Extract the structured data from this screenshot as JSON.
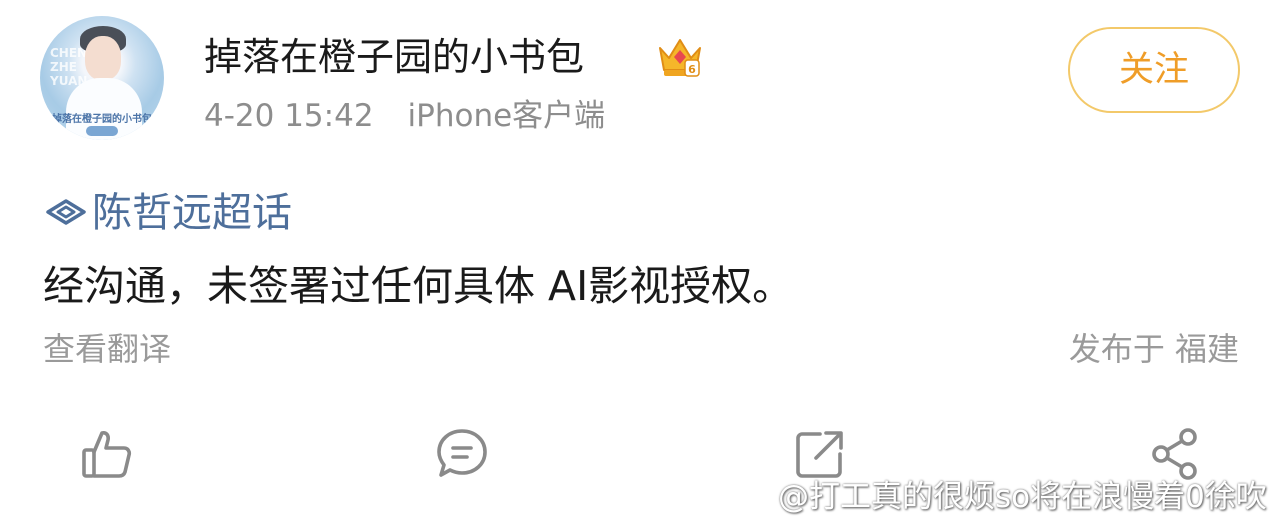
{
  "post": {
    "username": "掉落在橙子园的小书包",
    "timestamp": "4-20 15:42",
    "source": "iPhone客户端",
    "follow_label": "关注",
    "topic_label": "陈哲远超话",
    "content": "经沟通，未签署过任何具体 AI影视授权。",
    "translate_label": "查看翻译",
    "location": "发布于 福建"
  },
  "avatar": {
    "side_text": "CHEN ZHE YUAN",
    "banner_text": "掉落在橙子园的小书包"
  },
  "actions": [
    {
      "name": "like",
      "icon": "thumbs-up-icon"
    },
    {
      "name": "comment",
      "icon": "comment-icon"
    },
    {
      "name": "repost",
      "icon": "repost-icon"
    },
    {
      "name": "share",
      "icon": "share-icon"
    }
  ],
  "watermark": "@打工真的很烦so将在浪慢着0徐吹",
  "colors": {
    "follow_border": "#f3c96a",
    "follow_text": "#ef9d28",
    "topic": "#4e6f9b",
    "meta": "#8d8d8d",
    "icon": "#8a8a8a"
  }
}
